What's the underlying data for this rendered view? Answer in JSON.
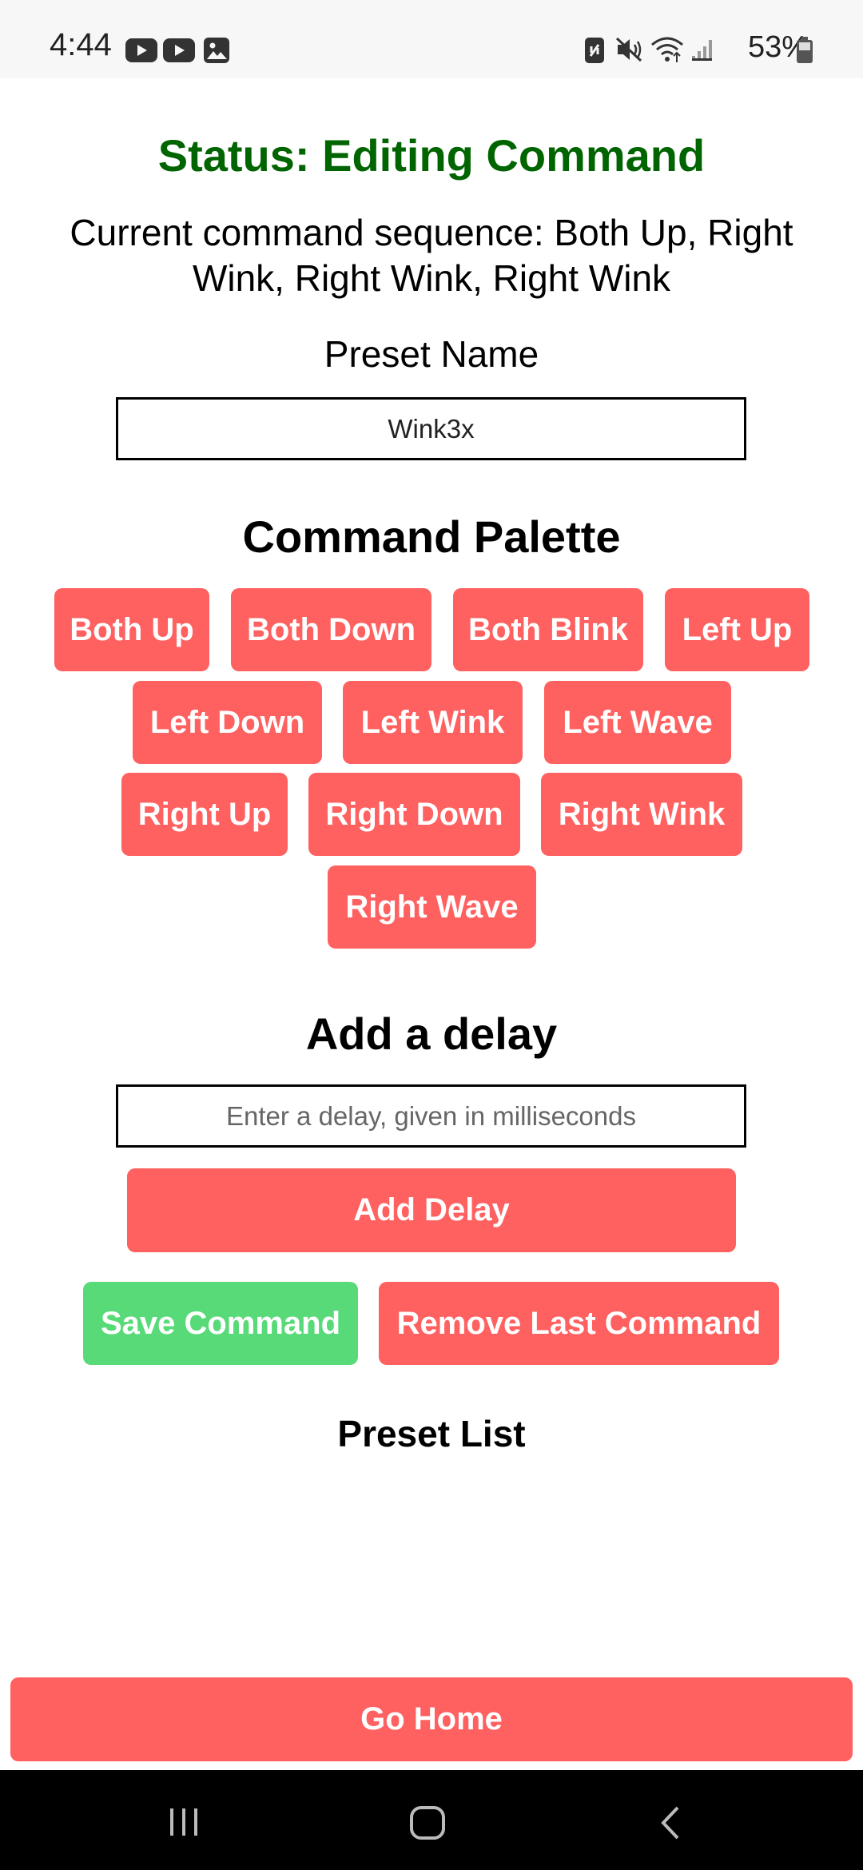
{
  "status_bar": {
    "time": "4:44",
    "battery": "53%",
    "left_icons": [
      "youtube-icon",
      "youtube-icon",
      "gallery-icon"
    ],
    "right_icons": [
      "nfc-icon",
      "mute-icon",
      "wifi-icon",
      "signal-icon",
      "battery-icon"
    ]
  },
  "status": {
    "title": "Status: Editing Command",
    "sequence": "Current command sequence: Both Up, Right Wink, Right Wink, Right Wink"
  },
  "preset": {
    "label": "Preset Name",
    "value": "Wink3x"
  },
  "palette": {
    "heading": "Command Palette",
    "buttons": [
      "Both Up",
      "Both Down",
      "Both Blink",
      "Left Up",
      "Left Down",
      "Left Wink",
      "Left Wave",
      "Right Up",
      "Right Down",
      "Right Wink",
      "Right Wave"
    ]
  },
  "delay": {
    "heading": "Add a delay",
    "placeholder": "Enter a delay, given in milliseconds",
    "add_label": "Add Delay"
  },
  "actions": {
    "save_label": "Save Command",
    "remove_label": "Remove Last Command"
  },
  "preset_list": {
    "label": "Preset List"
  },
  "go_home_label": "Go Home",
  "colors": {
    "accent_red": "#ff6060",
    "save_green": "#58da78",
    "status_green": "#006400"
  },
  "nav_bar": {
    "icons": [
      "recent-apps-icon",
      "home-icon",
      "back-icon"
    ]
  }
}
